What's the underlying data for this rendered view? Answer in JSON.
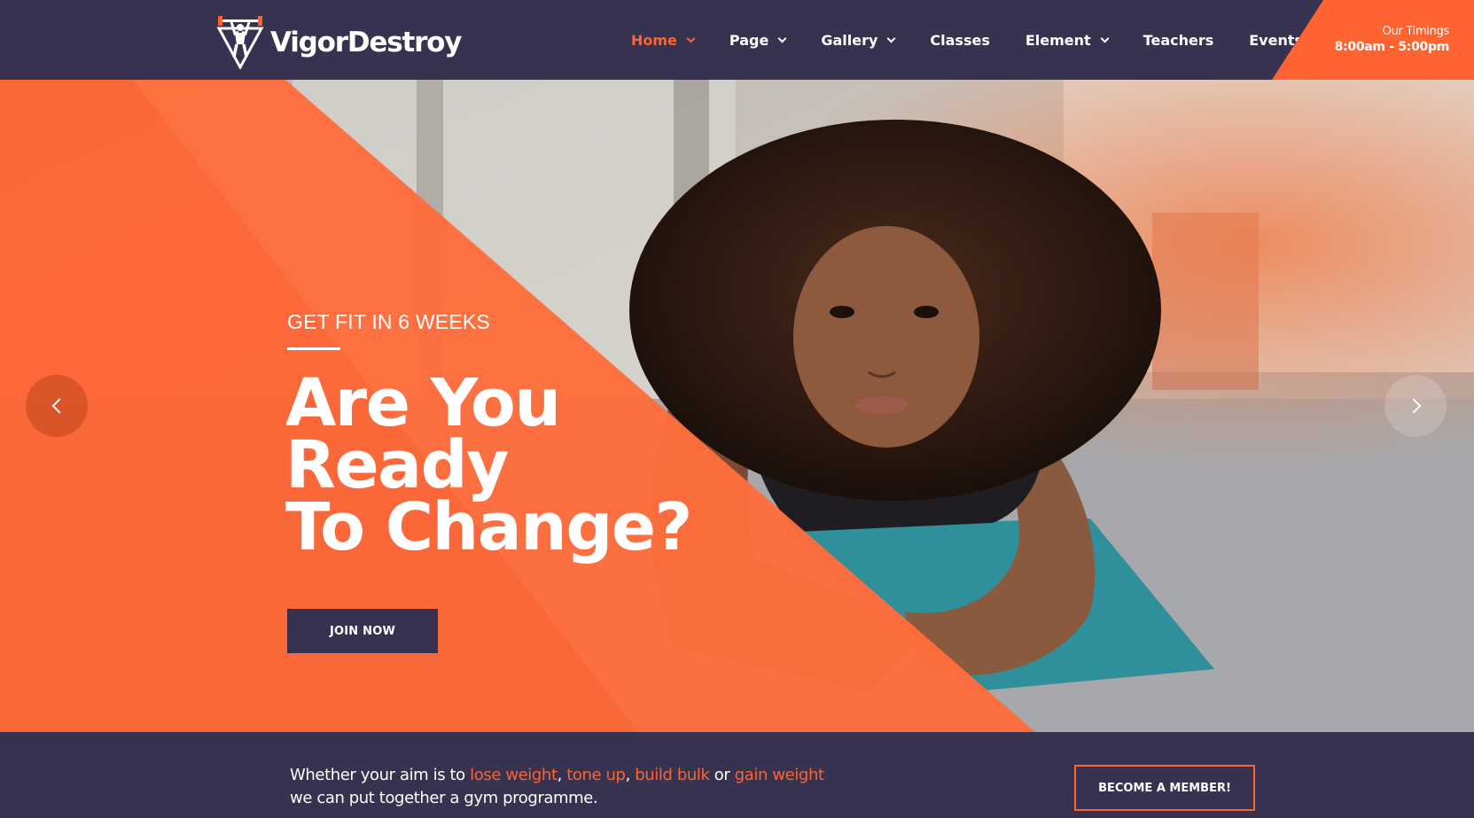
{
  "brand": {
    "name": "VigorDestroy"
  },
  "nav": {
    "items": [
      {
        "label": "Home",
        "has_dropdown": true,
        "active": true
      },
      {
        "label": "Page",
        "has_dropdown": true,
        "active": false
      },
      {
        "label": "Gallery",
        "has_dropdown": true,
        "active": false
      },
      {
        "label": "Classes",
        "has_dropdown": false,
        "active": false
      },
      {
        "label": "Element",
        "has_dropdown": true,
        "active": false
      },
      {
        "label": "Teachers",
        "has_dropdown": false,
        "active": false
      },
      {
        "label": "Events",
        "has_dropdown": false,
        "active": false
      }
    ]
  },
  "timings": {
    "label": "Our Timings",
    "hours": "8:00am - 5:00pm"
  },
  "hero": {
    "subtitle": "GET FIT IN 6 WEEKS",
    "title_lines": [
      "Are You",
      "Ready",
      "To Change?"
    ],
    "cta_label": "JOIN NOW",
    "prev_icon": "chevron-left-icon",
    "next_icon": "chevron-right-icon"
  },
  "promo": {
    "text_1": "Whether your aim is to ",
    "hl_1": "lose weight",
    "sep_1": ", ",
    "hl_2": "tone up",
    "sep_2": ", ",
    "hl_3": "build bulk",
    "sep_3": " or ",
    "hl_4": "gain weight",
    "text_2": "we can put together a gym programme.",
    "cta_label": "BECOME A MEMBER!"
  },
  "colors": {
    "accent": "#ff6331",
    "dark": "#363250",
    "text": "#ffffff"
  }
}
